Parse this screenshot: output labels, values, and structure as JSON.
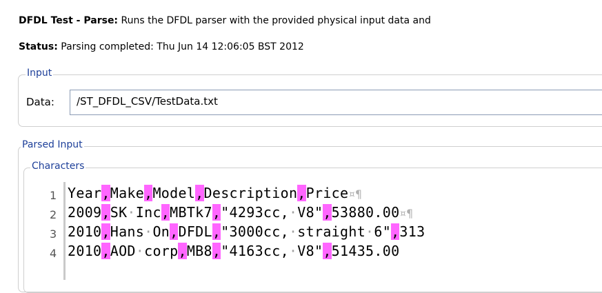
{
  "header": {
    "title_bold": "DFDL Test - Parse:",
    "title_desc": "Runs the DFDL parser with the provided physical input data and"
  },
  "status": {
    "label": "Status:",
    "text": "Parsing completed: Thu Jun 14 12:06:05 BST 2012"
  },
  "input_group": {
    "title": "Input",
    "data_label": "Data:",
    "data_value": "/ST_DFDL_CSV/TestData.txt"
  },
  "parsed_group": {
    "title": "Parsed Input",
    "characters_title": "Characters"
  },
  "editor": {
    "lines": [
      {
        "no": "1",
        "segments": [
          "Year",
          "Make",
          "Model",
          "Description",
          "Price"
        ],
        "eol": "¤¶"
      },
      {
        "no": "2",
        "segments": [
          "2009",
          "SK·Inc",
          "MBTk7",
          "\"4293cc,·V8\"",
          "53880.00"
        ],
        "eol": "¤¶"
      },
      {
        "no": "3",
        "segments": [
          "2010",
          "Hans·On",
          "DFDL",
          "\"3000cc,·straight·6\"",
          "313"
        ],
        "eol": ""
      },
      {
        "no": "4",
        "segments": [
          "2010",
          "AOD·corp",
          "MB8",
          "\"4163cc,·V8\"",
          "51435.00"
        ],
        "eol": ""
      }
    ],
    "separator": ",",
    "separator_color": "#ff66ff"
  }
}
